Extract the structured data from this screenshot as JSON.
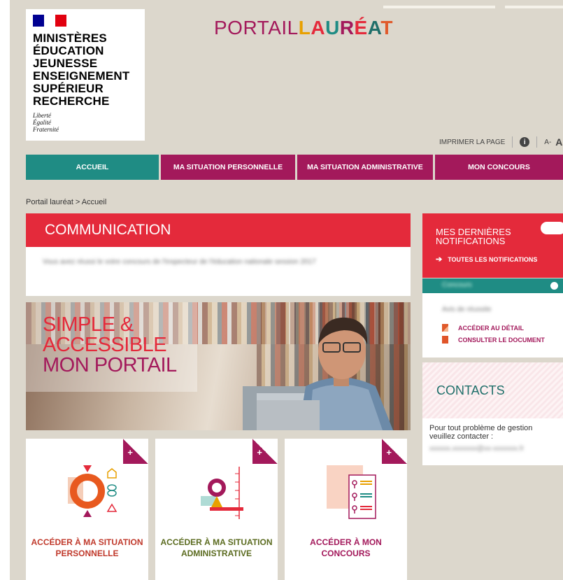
{
  "logo": {
    "lines": [
      "MINISTÈRES",
      "ÉDUCATION",
      "JEUNESSE",
      "ENSEIGNEMENT",
      "SUPÉRIEUR",
      "RECHERCHE"
    ],
    "motto": [
      "Liberté",
      "Égalité",
      "Fraternité"
    ]
  },
  "portal": {
    "title_part1": "PORTAIL",
    "title_part2": "LAURÉAT"
  },
  "utility": {
    "print_label": "IMPRIMER LA PAGE",
    "font_small": "A-",
    "font_large": "A"
  },
  "nav": {
    "accueil": "ACCUEIL",
    "personal": "MA SITUATION PERSONNELLE",
    "admin": "MA SITUATION ADMINISTRATIVE",
    "concours": "MON CONCOURS"
  },
  "breadcrumb": "Portail lauréat > Accueil",
  "communication": {
    "title": "COMMUNICATION",
    "body": "Vous avez réussi le votre concours de l'inspecteur de l'éducation nationale session 2017"
  },
  "banner": {
    "line1": "SIMPLE &",
    "line2": "ACCESSIBLE",
    "line3": "MON PORTAIL"
  },
  "cards": [
    {
      "label": "ACCÉDER À MA SITUATION PERSONNELLE",
      "plus": "+"
    },
    {
      "label": "ACCÉDER À MA SITUATION ADMINISTRATIVE",
      "plus": "+"
    },
    {
      "label": "ACCÉDER À MON CONCOURS",
      "plus": "+"
    }
  ],
  "notifications": {
    "title": "MES DERNIÈRES NOTIFICATIONS",
    "all_link": "TOUTES LES NOTIFICATIONS",
    "item_blurred": "Concours",
    "detail_blurred": "Avis de réussite",
    "detail_link": "ACCÉDER AU DÉTAIL",
    "document_link": "CONSULTER LE DOCUMENT"
  },
  "contacts": {
    "title": "CONTACTS",
    "text": "Pour tout problème de gestion veuillez contacter :",
    "email_blurred": "xxxxxx.xxxxxxx@xx-xxxxxxx.fr"
  },
  "colors": {
    "teal": "#1f8c84",
    "magenta": "#a3195b",
    "red": "#e42a3b"
  },
  "icons": {
    "print": "info-icon",
    "arrow": "arrow-right-icon"
  }
}
